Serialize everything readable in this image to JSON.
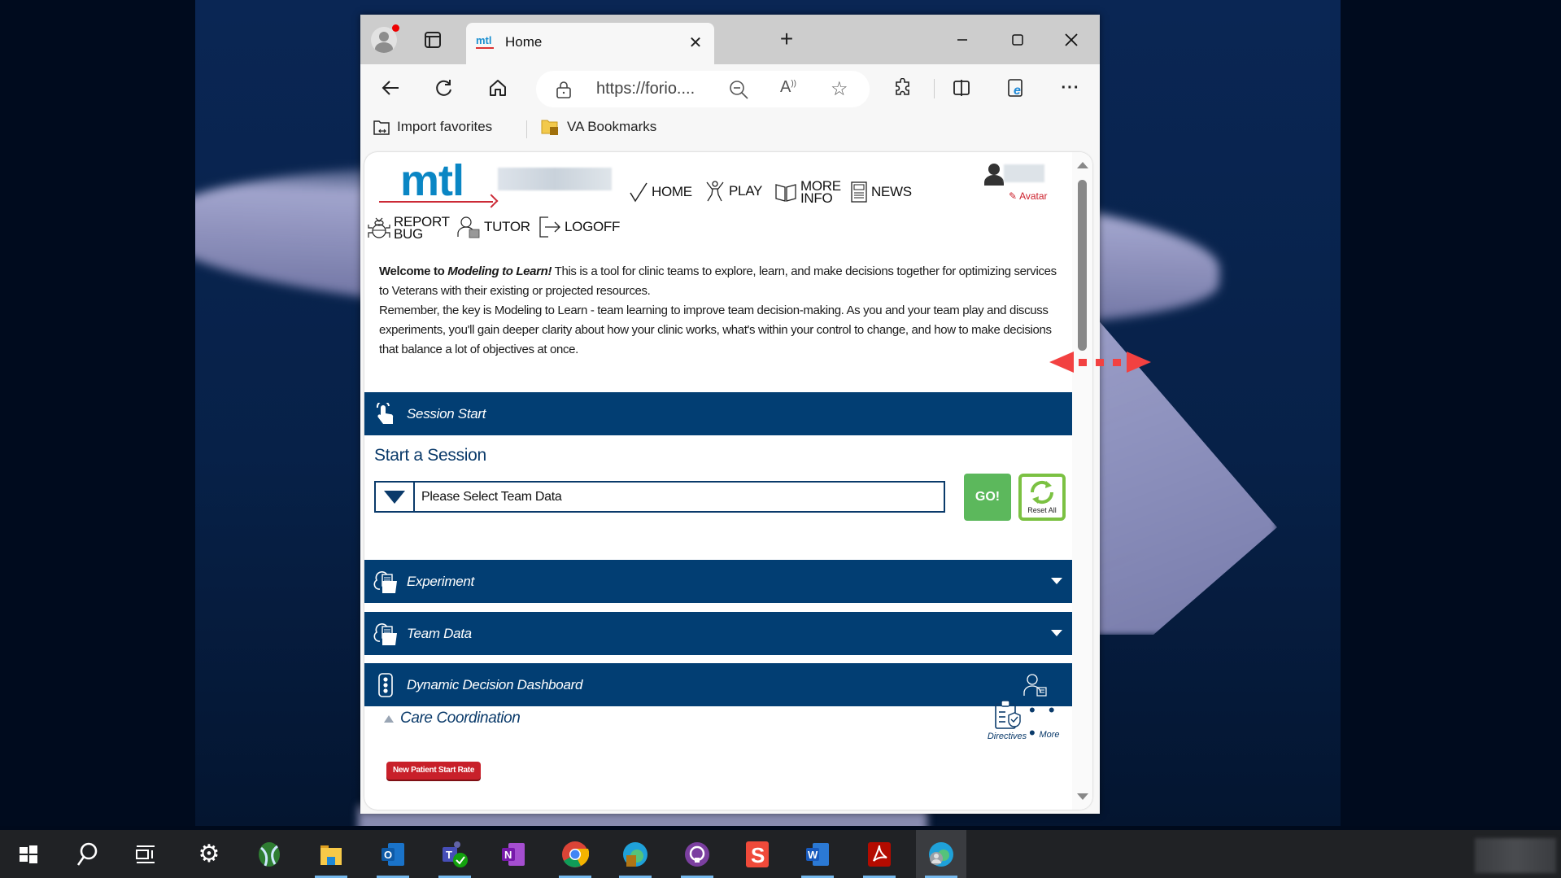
{
  "browser": {
    "tab": {
      "favicon": "mtl",
      "title": "Home",
      "close_icon": "close-icon"
    },
    "new_tab_label": "+",
    "window_controls": [
      "minimize",
      "maximize",
      "close"
    ],
    "address": {
      "url": "https://forio...."
    },
    "bookmarks": [
      {
        "label": "Import favorites",
        "icon": "import-favorites-icon"
      },
      {
        "label": "VA Bookmarks",
        "icon": "folder-icon"
      }
    ]
  },
  "app": {
    "logo_text": "mtl",
    "nav": {
      "home": "HOME",
      "play": "PLAY",
      "more_info_1": "MORE",
      "more_info_2": "INFO",
      "news": "NEWS",
      "report_1": "REPORT",
      "report_2": "BUG",
      "tutor": "TUTOR",
      "logoff": "LOGOFF"
    },
    "avatar_link": "Avatar",
    "intro": {
      "welcome": "Welcome to ",
      "app_name": "Modeling to Learn!",
      "line1": " This is a tool for clinic teams to explore, learn, and make decisions together for optimizing services to Veterans with their existing or projected resources.",
      "line2": "Remember, the key is Modeling to Learn - team learning to improve team decision-making. As you and your team play and discuss experiments, you'll gain deeper clarity about how your clinic works, what's within your control to change, and how to make decisions that balance a lot of objectives at once."
    },
    "panels": {
      "session_start": "Session Start",
      "experiment": "Experiment",
      "team_data": "Team Data",
      "ddd": "Dynamic Decision Dashboard"
    },
    "session": {
      "title": "Start a Session",
      "select_value": "Please Select Team Data",
      "go_label": "GO!",
      "reset_label": "Reset All"
    },
    "dashboard": {
      "section_title": "Care Coordination",
      "directives_label": "Directives",
      "more_label": "More",
      "more_dots": "• • •",
      "badge_label": "New Patient Start Rate"
    }
  },
  "colors": {
    "brand_blue": "#023e73",
    "logo_blue": "#0a86c4",
    "accent_red": "#cc2a36",
    "go_green": "#5cb85c",
    "reset_green": "#7bc142"
  },
  "taskbar": {
    "items": [
      "start",
      "search",
      "task-view",
      "settings",
      "network-app",
      "file-explorer",
      "outlook",
      "teams",
      "onenote",
      "chrome",
      "edge-dev",
      "github-desktop",
      "snagit",
      "word",
      "acrobat",
      "edge-profile"
    ]
  }
}
